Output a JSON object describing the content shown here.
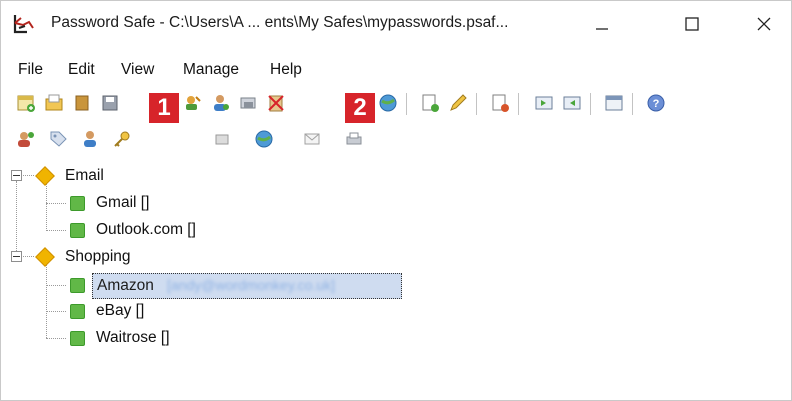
{
  "window": {
    "title": "Password Safe - C:\\Users\\A ... ents\\My Safes\\mypasswords.psaf...",
    "minimize_glyph": "—",
    "maximize_glyph": "☐",
    "close_glyph": "✕"
  },
  "menu": [
    {
      "label": "File"
    },
    {
      "label": "Edit"
    },
    {
      "label": "View"
    },
    {
      "label": "Manage"
    },
    {
      "label": "Help"
    }
  ],
  "callouts": {
    "one": "1",
    "two": "2"
  },
  "tree": {
    "groups": [
      {
        "name": "Email",
        "entries": [
          {
            "label": "Gmail []"
          },
          {
            "label": "Outlook.com []"
          }
        ]
      },
      {
        "name": "Shopping",
        "entries": [
          {
            "label": "Amazon",
            "user_blurred": "[andy@wordmonkey.co.uk]",
            "selected": true
          },
          {
            "label": "eBay []"
          },
          {
            "label": "Waitrose []"
          }
        ]
      }
    ]
  },
  "icons": {
    "toolbar1": [
      "new-database-icon",
      "open-database-icon",
      "close-database-icon",
      "save-database-icon",
      "copy-password-icon",
      "copy-username-icon",
      "copy-notes-icon",
      "clear-clipboard-icon",
      "browse-url-icon",
      "add-entry-icon",
      "edit-entry-icon",
      "delete-entry-icon",
      "expand-all-icon",
      "collapse-all-icon",
      "options-icon",
      "help-icon"
    ],
    "toolbar2": [
      "add-group-icon",
      "tag-icon",
      "user-icon",
      "key-icon",
      "notes-icon",
      "globe-icon",
      "email-icon",
      "print-icon"
    ]
  },
  "colors": {
    "accent_callout": "#d7242a",
    "selection": "#cfdcf0",
    "entry": "#61b847",
    "group": "#f0b400"
  }
}
